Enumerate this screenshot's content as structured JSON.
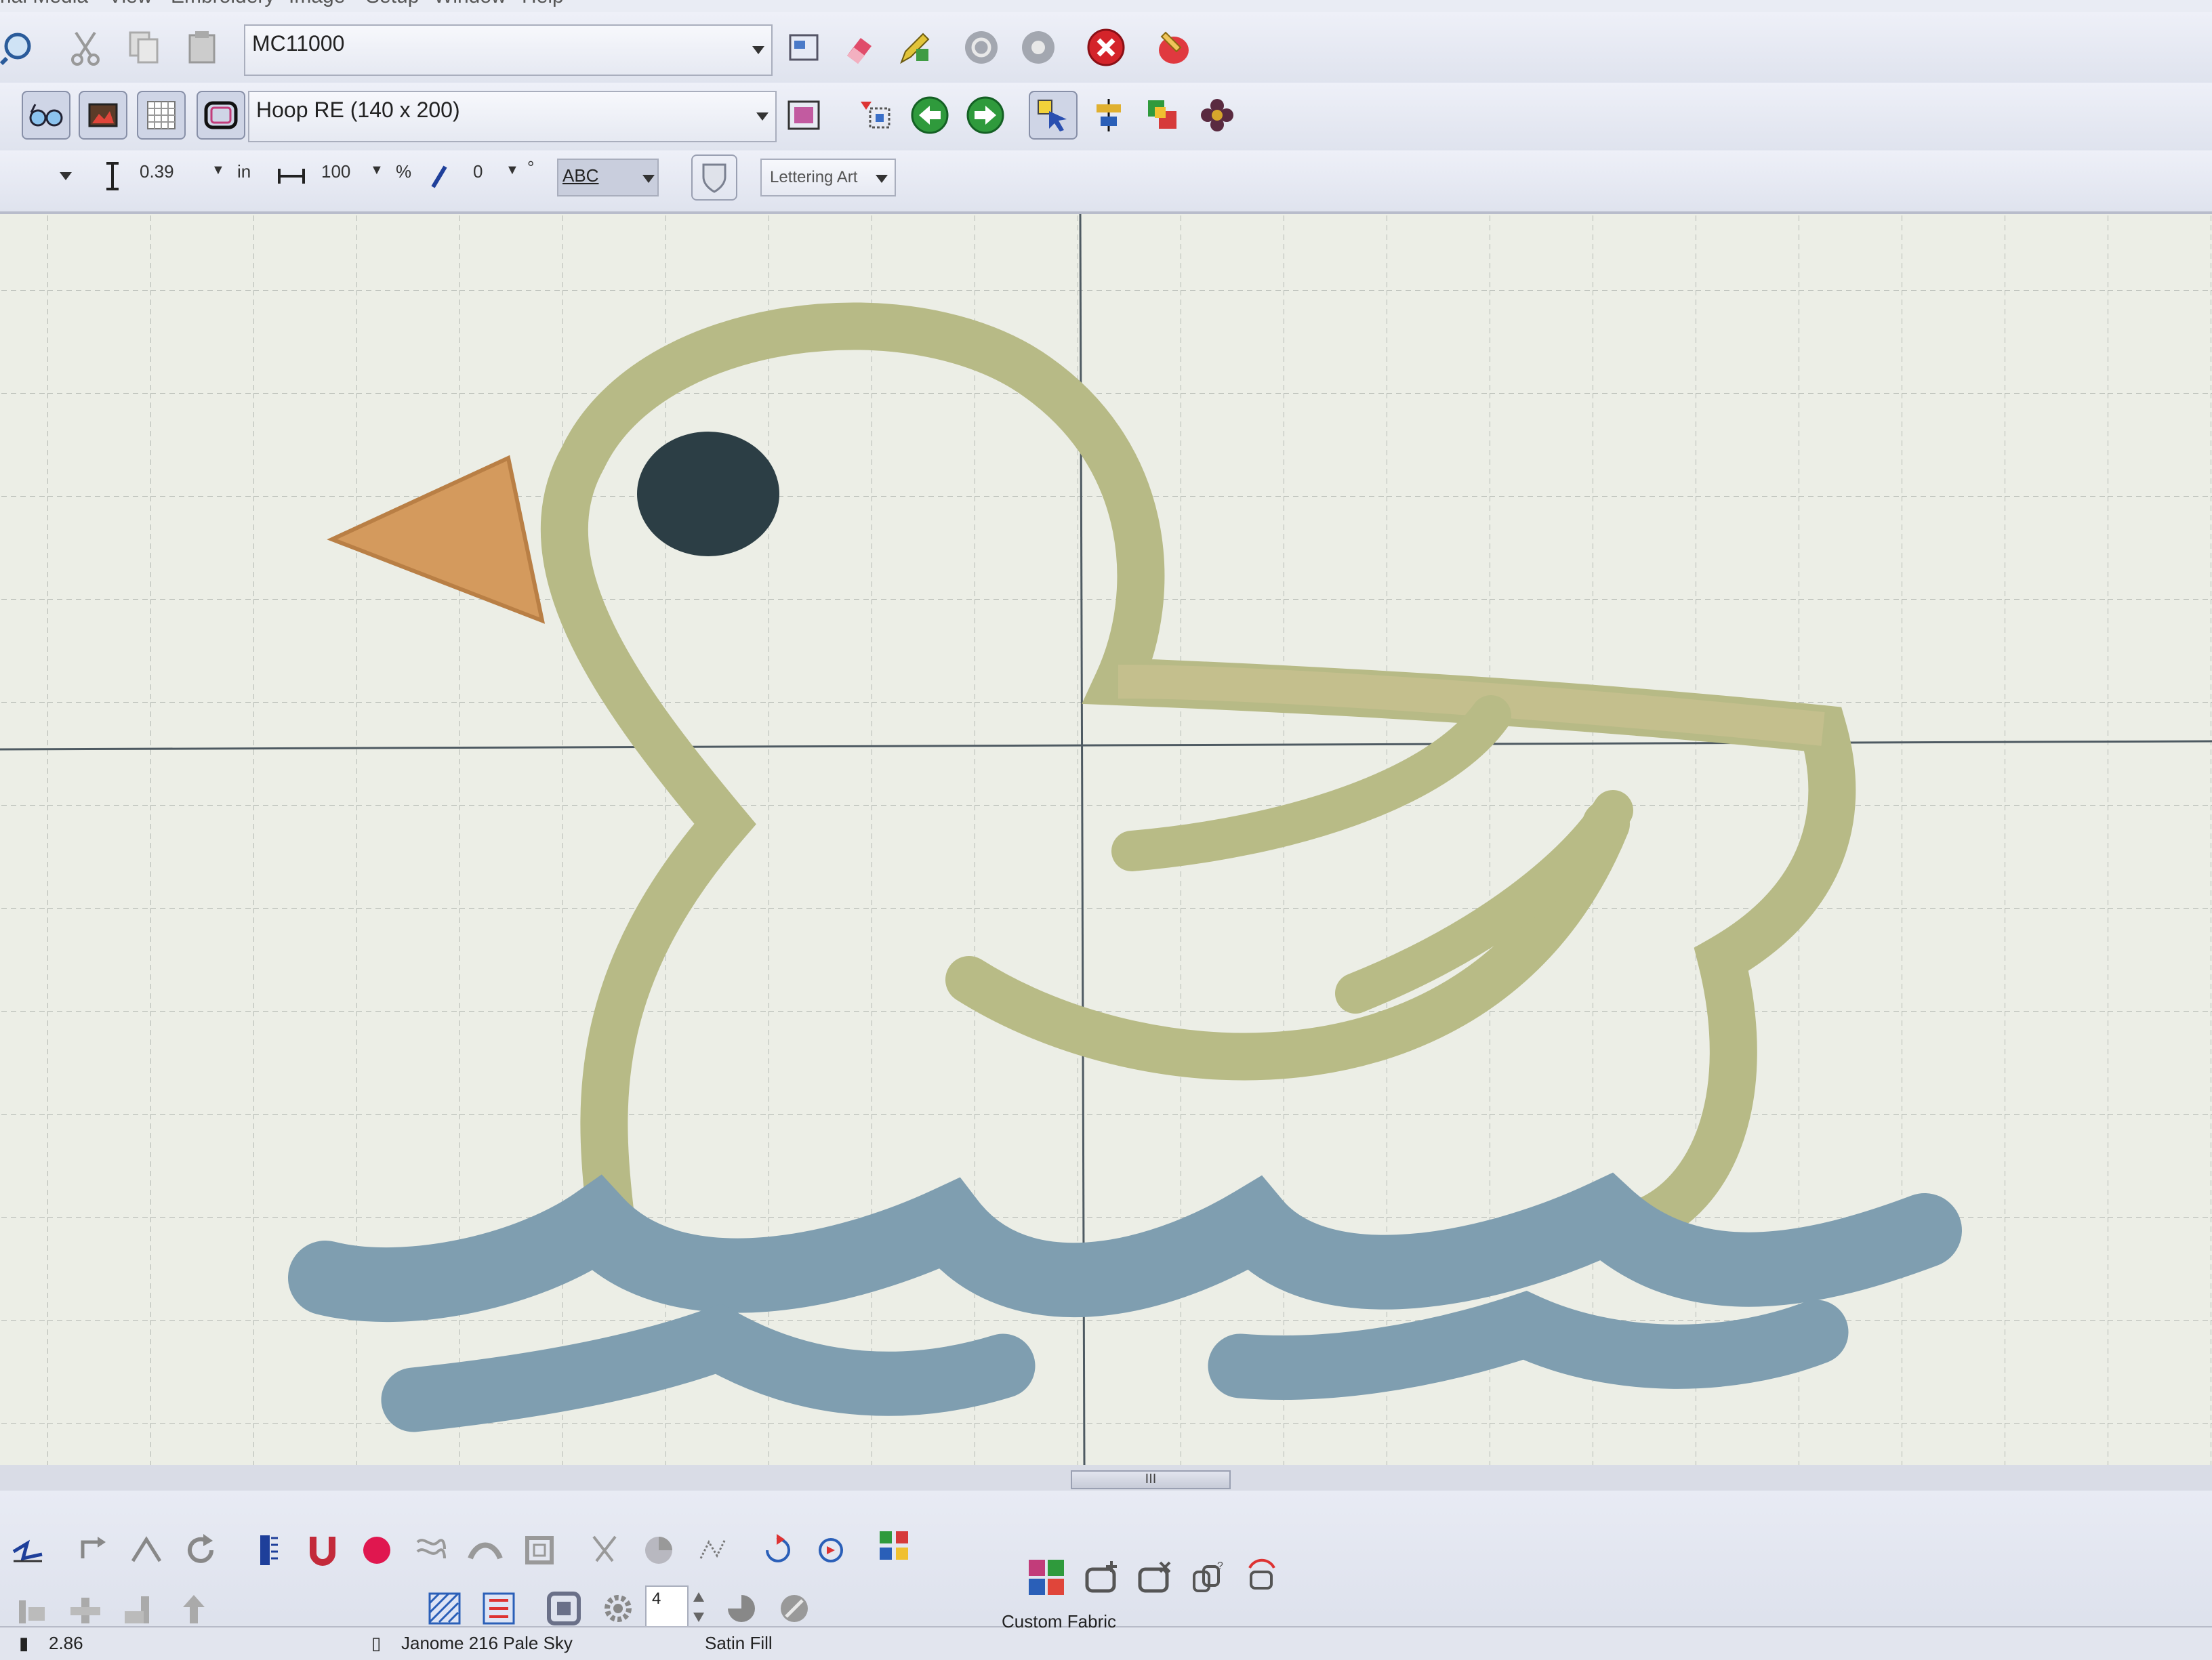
{
  "menu": {
    "items": [
      "rial Media",
      "View",
      "Embroidery",
      "Image",
      "Setup",
      "Window",
      "Help"
    ]
  },
  "toolbar1": {
    "design_name": "MC11000"
  },
  "toolbar2": {
    "hoop": "Hoop RE (140 x 200)"
  },
  "toolbar3": {
    "height_value": "0.39",
    "height_unit": "in",
    "width_value": "100",
    "width_unit": "%",
    "slant_value": "0",
    "slant_unit": "°",
    "font_preview": "ABC",
    "lettering_art": "Lettering Art"
  },
  "canvas": {
    "scroll_thumb": "III"
  },
  "bottom": {
    "spin_value": "4"
  },
  "status": {
    "zoom": "2.86",
    "thread": "Janome 216 Pale Sky",
    "stitch_type": "Satin Fill",
    "fabric": "Custom Fabric"
  },
  "colors": {
    "duck_body": "#b7ba86",
    "beak": "#d49a5d",
    "eye": "#2c3e45",
    "water": "#7f9eb0",
    "grid": "#b9beb8"
  }
}
